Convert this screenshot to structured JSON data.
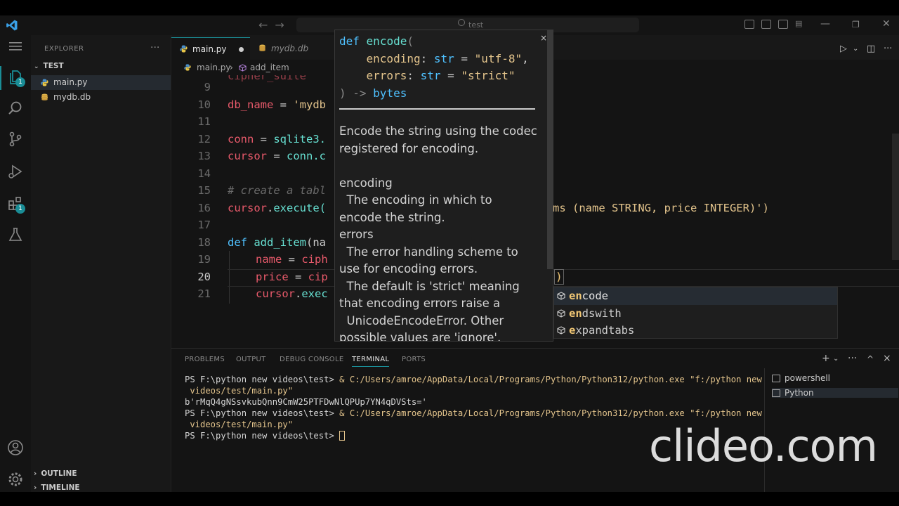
{
  "titlebar": {
    "search_text": "test"
  },
  "activity": {
    "explorer_badge": "1",
    "extensions_badge": "1"
  },
  "sidebar": {
    "title": "EXPLORER",
    "more": "···",
    "folder": "TEST",
    "files": [
      "main.py",
      "mydb.db"
    ],
    "outline": "OUTLINE",
    "timeline": "TIMELINE"
  },
  "tabs": [
    {
      "label": "main.py"
    },
    {
      "label": "mydb.db"
    }
  ],
  "breadcrumb": {
    "file": "main.py",
    "sep": "›",
    "symbol": "add_item"
  },
  "editor": {
    "lines": [
      {
        "n": "9"
      },
      {
        "n": "10",
        "t1": "db_name",
        "t2": " = ",
        "t3": "'mydb"
      },
      {
        "n": "11"
      },
      {
        "n": "12",
        "t1": "conn",
        "t2": " = ",
        "t3": "sqlite3."
      },
      {
        "n": "13",
        "t1": "cursor",
        "t2": " = ",
        "t3": "conn.c"
      },
      {
        "n": "14"
      },
      {
        "n": "15",
        "t1": "# create a tabl"
      },
      {
        "n": "16",
        "t1": "cursor",
        "t2": ".",
        "t3": "execute(",
        "t4": "ms (name STRING, price INTEGER)')"
      },
      {
        "n": "17"
      },
      {
        "n": "18",
        "t1": "def",
        "t2": " ",
        "t3": "add_item",
        "t4": "(na"
      },
      {
        "n": "19",
        "t1": "name",
        "t2": " = ",
        "t3": "ciph"
      },
      {
        "n": "20",
        "t1": "price",
        "t2": " = ",
        "t3": "cip"
      },
      {
        "n": "21",
        "t1": "cursor",
        "t2": ".",
        "t3": "exec"
      }
    ]
  },
  "hover": {
    "sig": {
      "l1_def": "def",
      "l1_fn": "encode",
      "l1_paren": "(",
      "l2_param": "encoding",
      "l2_colon": ": ",
      "l2_type": "str",
      "l2_eq": " = ",
      "l2_val": "\"utf-8\"",
      "l2_comma": ",",
      "l3_param": "errors",
      "l3_colon": ": ",
      "l3_type": "str",
      "l3_eq": " = ",
      "l3_val": "\"strict\"",
      "l4_close": ") -> ",
      "l4_ret": "bytes"
    },
    "close": "×",
    "doc": "Encode the string using the codec\nregistered for encoding.\n\nencoding\n  The encoding in which to\nencode the string.\nerrors\n  The error handling scheme to\nuse for encoding errors.\n  The default is 'strict' meaning\nthat encoding errors raise a\n  UnicodeEncodeError. Other\npossible values are 'ignore',"
  },
  "suggest": {
    "items": [
      {
        "match": "en",
        "rest": "code"
      },
      {
        "match": "en",
        "rest": "dswith"
      },
      {
        "match": "e",
        "rest": "xpandtabs"
      }
    ],
    "paren": ")"
  },
  "panel": {
    "tabs": [
      "PROBLEMS",
      "OUTPUT",
      "DEBUG CONSOLE",
      "TERMINAL",
      "PORTS"
    ],
    "actions": {
      "add": "+",
      "dropdown": "⌄",
      "more": "···",
      "maximize": "^",
      "close": "×"
    },
    "terminal": {
      "prompt": "PS F:\\python new videos\\test> ",
      "amp": "& ",
      "cmd1": "C:/Users/amroe/AppData/Local/Programs/Python/Python312/python.exe \"f:/python new",
      "cmd1b": " videos/test/main.py\"",
      "out": "b'rMqQ4gNSsvkubQnn9CmW25PTFDwNlQPUp7YN4qDVSts='",
      "cmd2": "C:/Users/amroe/AppData/Local/Programs/Python/Python312/python.exe \"f:/python new",
      "cmd2b": " videos/test/main.py\""
    },
    "terminals": [
      "powershell",
      "Python"
    ]
  },
  "watermark": "clideo.com",
  "colors": {
    "accent": "#1a8d96",
    "keyword": "#4fc1ff",
    "function": "#67e0d2",
    "variable": "#e95a6b",
    "string": "#e3c48c"
  }
}
